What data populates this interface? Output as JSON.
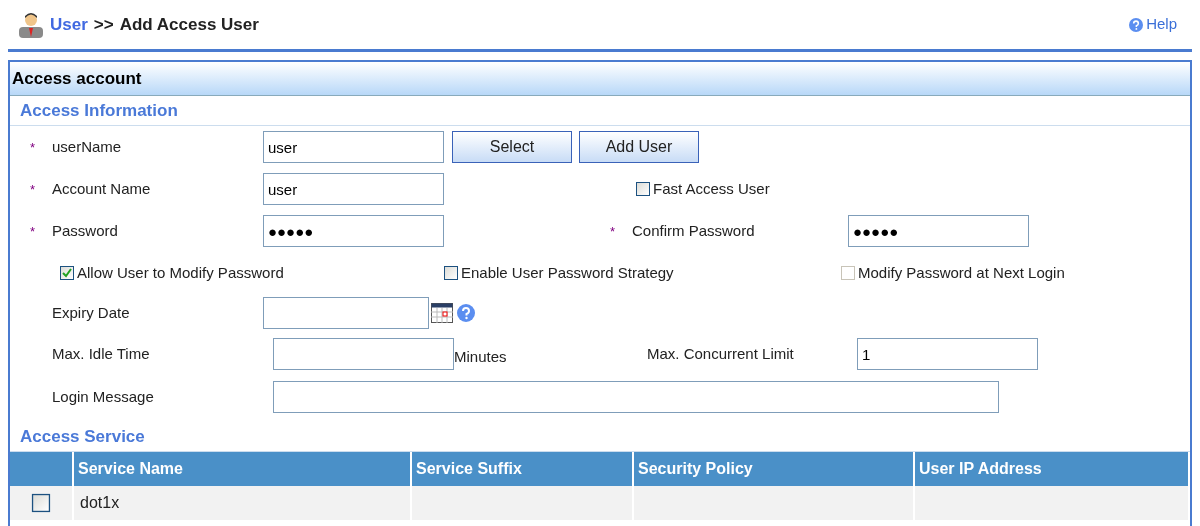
{
  "breadcrumb": {
    "link": "User",
    "separator": ">>",
    "current": "Add Access User"
  },
  "help": "Help",
  "panel_title": "Access account",
  "access_information": {
    "title": "Access Information",
    "user_name": {
      "label": "userName",
      "marker": "*",
      "value": "user"
    },
    "buttons": [
      "Select",
      "Add User"
    ],
    "account_name": {
      "label": "Account Name",
      "marker": "*",
      "value": "user"
    },
    "fast_access": {
      "label": "Fast Access User",
      "checked": false,
      "disabled": false
    },
    "password": {
      "label": "Password",
      "marker": "*",
      "value": "●●●●●"
    },
    "confirm_password": {
      "label": "Confirm Password",
      "marker": "*",
      "value": "●●●●●"
    },
    "options": [
      {
        "label": "Allow User to Modify Password",
        "checked": true,
        "disabled": false
      },
      {
        "label": "Enable User Password Strategy",
        "checked": false,
        "disabled": false
      },
      {
        "label": "Modify Password at Next Login",
        "checked": false,
        "disabled": true
      }
    ],
    "expiry_date": {
      "label": "Expiry Date"
    },
    "max_idle_time": {
      "label": "Max. Idle Time",
      "unit": "Minutes"
    },
    "max_concurrent": {
      "label": "Max. Concurrent Limit",
      "value": "1"
    },
    "login_message": {
      "label": "Login Message"
    }
  },
  "access_service": {
    "title": "Access Service",
    "columns": [
      "Service Name",
      "Service Suffix",
      "Security Policy",
      "User IP Address"
    ],
    "rows": [
      {
        "checked": false,
        "cells": [
          "dot1x",
          "",
          "",
          ""
        ]
      }
    ]
  }
}
